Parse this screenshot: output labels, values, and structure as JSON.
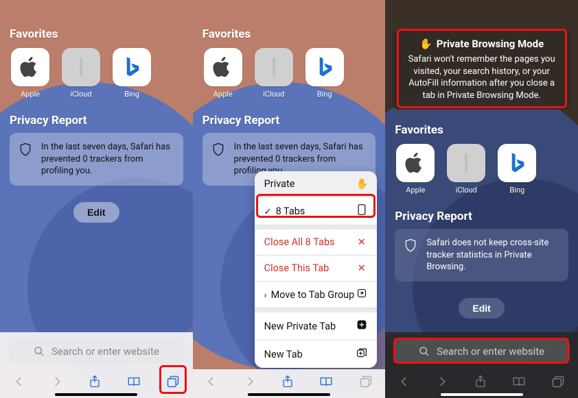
{
  "common": {
    "favorites_header": "Favorites",
    "privacy_header": "Privacy Report",
    "edit_label": "Edit",
    "search_placeholder": "Search or enter website",
    "favorites": [
      {
        "label": "Apple"
      },
      {
        "label": "iCloud"
      },
      {
        "label": "Bing"
      }
    ]
  },
  "screen1": {
    "report_text": "In the last seven days, Safari has prevented 0 trackers from profiling you."
  },
  "screen2": {
    "report_text": "In the last seven days, Safari has prevented 0 trackers from profiling you.",
    "sheet": {
      "private": "Private",
      "tabs": "8 Tabs",
      "close_all": "Close All 8 Tabs",
      "close_this": "Close This Tab",
      "move_group": "Move to Tab Group",
      "new_private": "New Private Tab",
      "new_tab": "New Tab"
    }
  },
  "screen3": {
    "tooltip_title": "Private Browsing Mode",
    "tooltip_body": "Safari won't remember the pages you visited, your search history, or your AutoFill information after you close a tab in Private Browsing Mode.",
    "report_text": "Safari does not keep cross-site tracker statistics in Private Browsing."
  }
}
